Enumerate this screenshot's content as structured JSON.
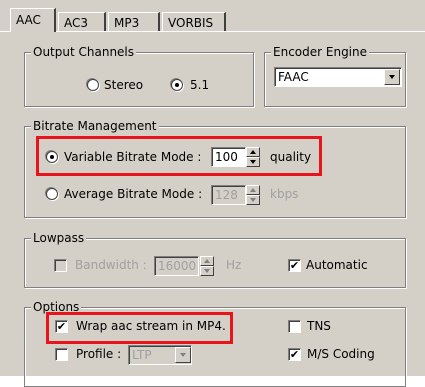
{
  "tabs": [
    "AAC",
    "AC3",
    "MP3",
    "VORBIS"
  ],
  "output_channels": {
    "title": "Output Channels",
    "options": [
      "Stereo",
      "5.1"
    ],
    "selected": "5.1"
  },
  "encoder_engine": {
    "title": "Encoder Engine",
    "value": "FAAC"
  },
  "bitrate": {
    "title": "Bitrate Management",
    "vbr_label": "Variable Bitrate Mode :",
    "vbr_value": "100",
    "vbr_unit": "quality",
    "abr_label": "Average Bitrate Mode :",
    "abr_value": "128",
    "abr_unit": "kbps",
    "selected": "Variable Bitrate Mode"
  },
  "lowpass": {
    "title": "Lowpass",
    "bandwidth_label": "Bandwidth :",
    "bandwidth_value": "16000",
    "bandwidth_unit": "Hz",
    "automatic_label": "Automatic",
    "automatic_checked": true
  },
  "options": {
    "title": "Options",
    "wrap_label": "Wrap aac stream in MP4.",
    "wrap_checked": true,
    "tns_label": "TNS",
    "tns_checked": false,
    "profile_label": "Profile :",
    "profile_value": "LTP",
    "profile_checked": false,
    "ms_label": "M/S Coding",
    "ms_checked": true
  },
  "check_glyph": "✔",
  "highlight_color": "#e8141b"
}
